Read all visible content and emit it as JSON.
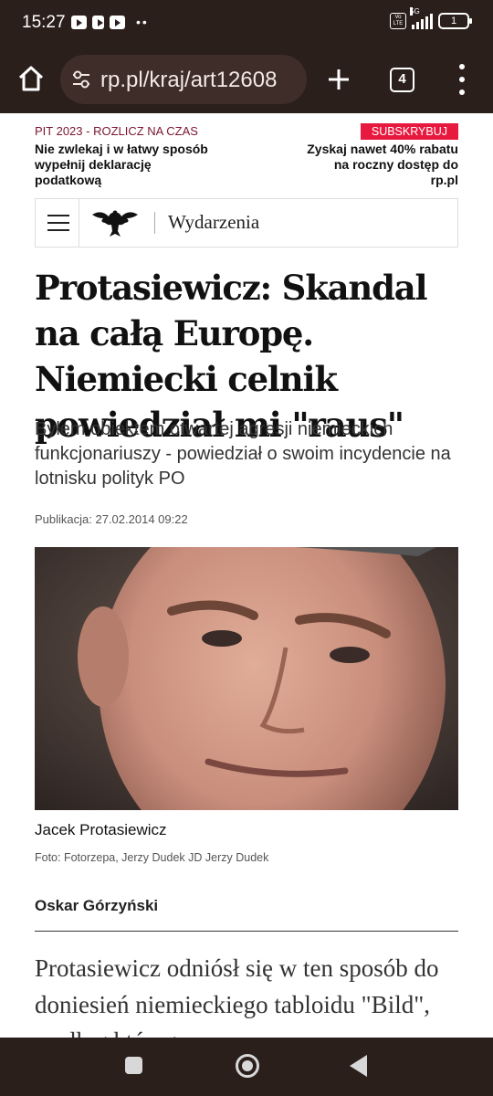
{
  "status_bar": {
    "time": "15:27",
    "network": "5G",
    "volte": "Vo LTE",
    "battery": "1"
  },
  "browser": {
    "url": "rp.pl/kraj/art12608",
    "tab_count": "4",
    "icons": [
      "home-icon",
      "site-settings-icon",
      "plus-icon",
      "tabs-icon",
      "more-vert-icon"
    ]
  },
  "promo": {
    "left_title": "PIT 2023 - ROZLICZ NA CZAS",
    "left_text": "Nie zwlekaj i w łatwy sposób wypełnij deklarację podatkową",
    "subscribe_label": "SUBSKRYBUJ",
    "right_text": "Zyskaj nawet 40% rabatu na roczny dostęp do rp.pl"
  },
  "nav": {
    "section": "Wydarzenia"
  },
  "article": {
    "headline": "Protasiewicz: Skandal na całą Europę. Niemiecki celnik powiedział mi \"raus\"",
    "lead": "Byłem obiektem otwartej agresji niemieckich funkcjonariuszy - powiedział o swoim incydencie na lotnisku polityk PO",
    "publication": "Publikacja: 27.02.2014 09:22",
    "photo_caption": "Jacek Protasiewicz",
    "photo_credit": "Foto: Fotorzepa, Jerzy Dudek JD Jerzy Dudek",
    "author": "Oskar Górzyński",
    "body": "Protasiewicz odniósł się w ten sposób do doniesień niemieckiego tabloidu \"Bild\", według którego"
  },
  "colors": {
    "chrome": "#2b1f1c",
    "url_pill": "#3e2d29",
    "promo_title": "#7a1530",
    "subscribe": "#e8193f"
  }
}
